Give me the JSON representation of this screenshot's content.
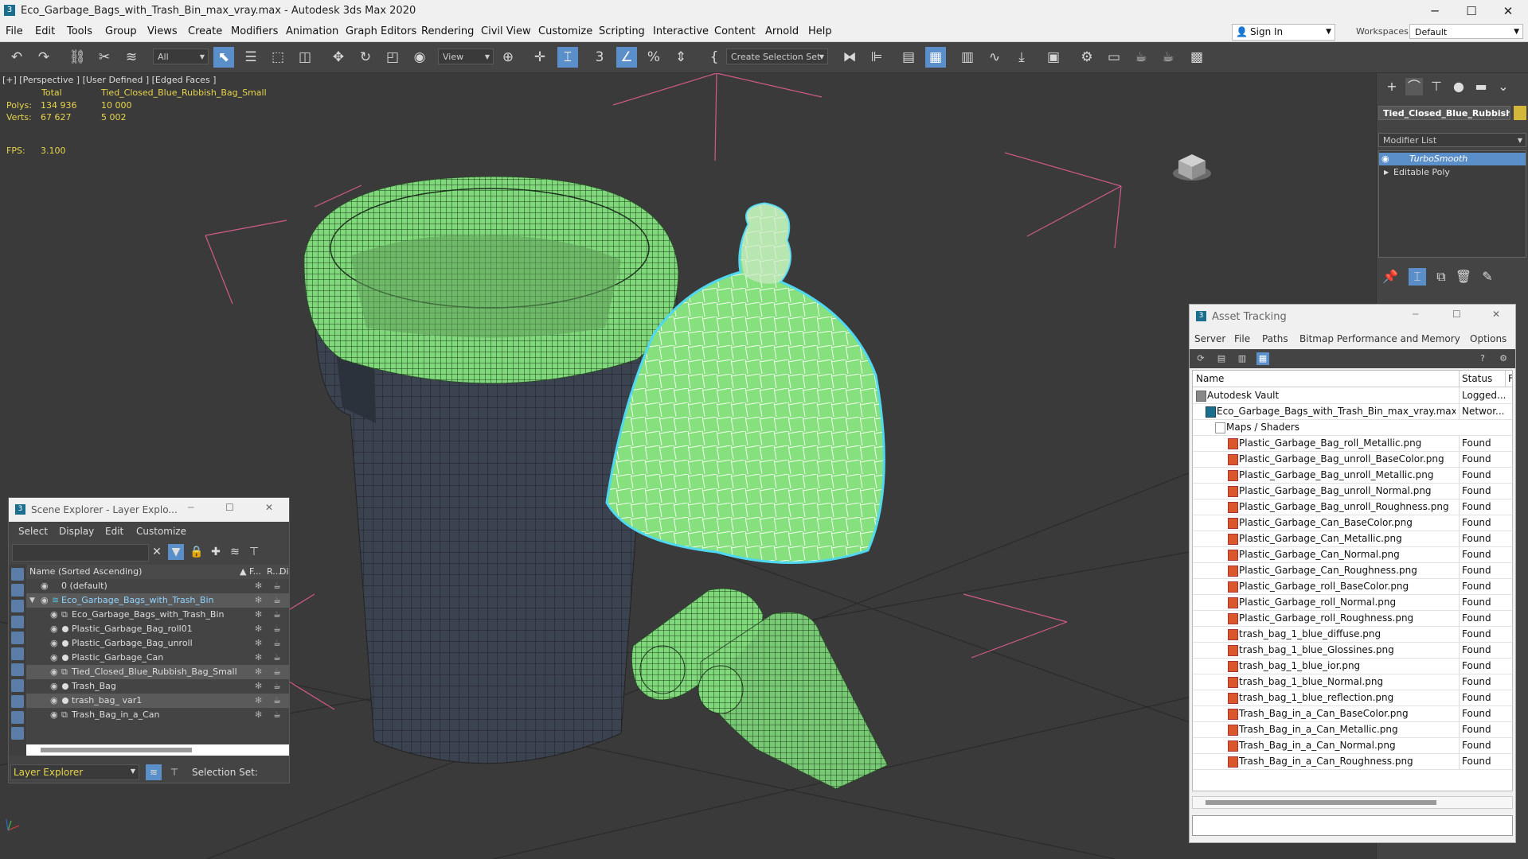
{
  "window": {
    "title": "Eco_Garbage_Bags_with_Trash_Bin_max_vray.max - Autodesk 3ds Max 2020",
    "minimize": "─",
    "maximize": "☐",
    "close": "✕"
  },
  "menubar": {
    "items": [
      "File",
      "Edit",
      "Tools",
      "Group",
      "Views",
      "Create",
      "Modifiers",
      "Animation",
      "Graph Editors",
      "Rendering",
      "Civil View",
      "Customize",
      "Scripting",
      "Interactive",
      "Content",
      "Arnold",
      "Help"
    ],
    "signin": "Sign In",
    "workspaces_label": "Workspaces:",
    "workspace_value": "Default"
  },
  "toolbar": {
    "filter_value": "All",
    "view_value": "View",
    "create_selection_set": "Create Selection Set"
  },
  "viewport": {
    "label": "[+] [Perspective ] [User Defined ] [Edged Faces ]",
    "stats": {
      "total_label": "Total",
      "object_name": "Tied_Closed_Blue_Rubbish_Bag_Small",
      "polys_label": "Polys:",
      "polys_total": "134 936",
      "polys_object": "10 000",
      "verts_label": "Verts:",
      "verts_total": "67 627",
      "verts_object": "5 002",
      "fps_label": "FPS:",
      "fps_value": "3.100"
    }
  },
  "command_panel": {
    "object_name": "Tied_Closed_Blue_Rubbish",
    "object_color": "#d4b63a",
    "modifier_list_label": "Modifier List",
    "stack": [
      "TurboSmooth",
      "Editable Poly"
    ]
  },
  "scene_explorer": {
    "title": "Scene Explorer - Layer Explo...",
    "menus": [
      "Select",
      "Display",
      "Edit",
      "Customize"
    ],
    "columns": {
      "name": "Name (Sorted Ascending)",
      "f": "▲ F...",
      "r": "R...",
      "d": "Di"
    },
    "rows": [
      {
        "name": "0 (default)",
        "indent": 0
      },
      {
        "name": "Eco_Garbage_Bags_with_Trash_Bin",
        "indent": 0
      },
      {
        "name": "Eco_Garbage_Bags_with_Trash_Bin",
        "indent": 1
      },
      {
        "name": "Plastic_Garbage_Bag_roll01",
        "indent": 1
      },
      {
        "name": "Plastic_Garbage_Bag_unroll",
        "indent": 1
      },
      {
        "name": "Plastic_Garbage_Can",
        "indent": 1
      },
      {
        "name": "Tied_Closed_Blue_Rubbish_Bag_Small",
        "indent": 1
      },
      {
        "name": "Trash_Bag",
        "indent": 1
      },
      {
        "name": "trash_bag_ var1",
        "indent": 1
      },
      {
        "name": "Trash_Bag_in_a_Can",
        "indent": 1
      }
    ],
    "footer_mode": "Layer Explorer",
    "selection_set_label": "Selection Set:"
  },
  "asset_tracking": {
    "title": "Asset Tracking",
    "menus": [
      "Server",
      "File",
      "Paths",
      "Bitmap Performance and Memory",
      "Options"
    ],
    "columns": {
      "name": "Name",
      "status": "Status",
      "extra": "F"
    },
    "rows": [
      {
        "name": "Autodesk Vault",
        "status": "Logged...",
        "level": 0
      },
      {
        "name": "Eco_Garbage_Bags_with_Trash_Bin_max_vray.max",
        "status": "Networ...",
        "level": 1
      },
      {
        "name": "Maps / Shaders",
        "status": "",
        "level": 2
      },
      {
        "name": "Plastic_Garbage_Bag_roll_Metallic.png",
        "status": "Found",
        "level": 3
      },
      {
        "name": "Plastic_Garbage_Bag_unroll_BaseColor.png",
        "status": "Found",
        "level": 3
      },
      {
        "name": "Plastic_Garbage_Bag_unroll_Metallic.png",
        "status": "Found",
        "level": 3
      },
      {
        "name": "Plastic_Garbage_Bag_unroll_Normal.png",
        "status": "Found",
        "level": 3
      },
      {
        "name": "Plastic_Garbage_Bag_unroll_Roughness.png",
        "status": "Found",
        "level": 3
      },
      {
        "name": "Plastic_Garbage_Can_BaseColor.png",
        "status": "Found",
        "level": 3
      },
      {
        "name": "Plastic_Garbage_Can_Metallic.png",
        "status": "Found",
        "level": 3
      },
      {
        "name": "Plastic_Garbage_Can_Normal.png",
        "status": "Found",
        "level": 3
      },
      {
        "name": "Plastic_Garbage_Can_Roughness.png",
        "status": "Found",
        "level": 3
      },
      {
        "name": "Plastic_Garbage_roll_BaseColor.png",
        "status": "Found",
        "level": 3
      },
      {
        "name": "Plastic_Garbage_roll_Normal.png",
        "status": "Found",
        "level": 3
      },
      {
        "name": "Plastic_Garbage_roll_Roughness.png",
        "status": "Found",
        "level": 3
      },
      {
        "name": "trash_bag_1_blue_diffuse.png",
        "status": "Found",
        "level": 3
      },
      {
        "name": "trash_bag_1_blue_Glossines.png",
        "status": "Found",
        "level": 3
      },
      {
        "name": "trash_bag_1_blue_ior.png",
        "status": "Found",
        "level": 3
      },
      {
        "name": "trash_bag_1_blue_Normal.png",
        "status": "Found",
        "level": 3
      },
      {
        "name": "trash_bag_1_blue_reflection.png",
        "status": "Found",
        "level": 3
      },
      {
        "name": "Trash_Bag_in_a_Can_BaseColor.png",
        "status": "Found",
        "level": 3
      },
      {
        "name": "Trash_Bag_in_a_Can_Metallic.png",
        "status": "Found",
        "level": 3
      },
      {
        "name": "Trash_Bag_in_a_Can_Normal.png",
        "status": "Found",
        "level": 3
      },
      {
        "name": "Trash_Bag_in_a_Can_Roughness.png",
        "status": "Found",
        "level": 3
      }
    ]
  },
  "colors": {
    "selection_highlight": "#5b8fc9",
    "stat_text": "#e8d44d",
    "mesh_green": "#7fd97a",
    "selection_outline": "#4fd8f0"
  }
}
